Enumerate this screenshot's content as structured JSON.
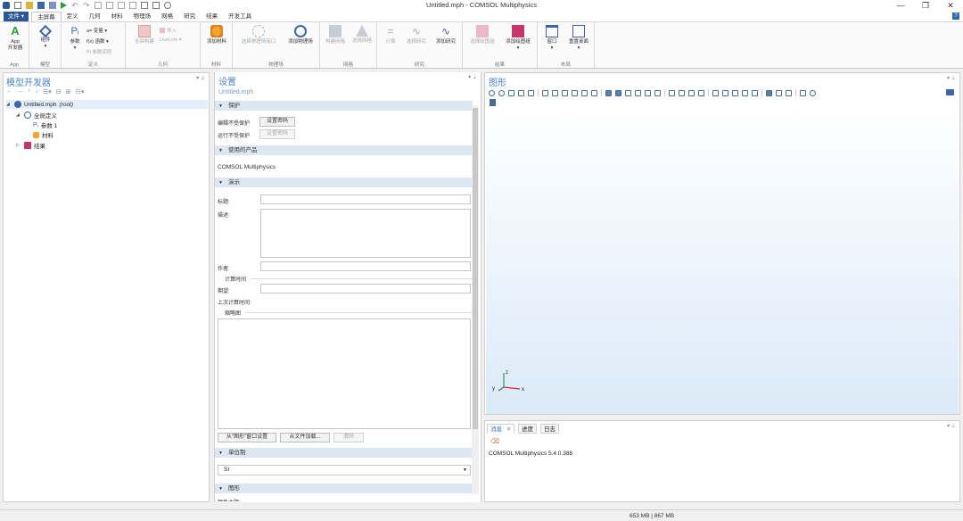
{
  "window": {
    "title": "Untitled.mph - COMSOL Multiphysics"
  },
  "ribbon": {
    "tabs": [
      "文件 ▾",
      "主屏幕",
      "定义",
      "几何",
      "材料",
      "物理场",
      "网格",
      "研究",
      "结果",
      "开发工具"
    ],
    "active_tab": "主屏幕",
    "groups": {
      "app": {
        "label": "App",
        "button": "App\n开发器"
      },
      "model": {
        "label": "模型",
        "button": "组件"
      },
      "definitions": {
        "label": "定义",
        "params": "参数",
        "variables": "a= 变量 ▾",
        "functions": "f(x) 函数 ▾",
        "param_case": "Pi 参数实例"
      },
      "geometry": {
        "label": "几何",
        "build_all": "全部构建",
        "import": "导入",
        "livelink": "LiveLink ▾"
      },
      "materials": {
        "label": "材料",
        "add_material": "添加材料"
      },
      "physics": {
        "label": "物理场",
        "select_iface": "选择物理场接口",
        "add_physics": "添加物理场"
      },
      "mesh": {
        "label": "网格",
        "build_mesh": "构建网格",
        "select_mesh": "选择网格"
      },
      "study": {
        "label": "研究",
        "compute": "计算",
        "select_study": "选择研究",
        "add_study": "添加研究"
      },
      "results": {
        "label": "结果",
        "select_plot": "选择绘图组",
        "add_plot": "添加绘图组"
      },
      "layout": {
        "label": "布局",
        "windows": "窗口",
        "reset_desktop": "重置桌面"
      }
    }
  },
  "model_builder": {
    "title": "模型开发器",
    "tree": [
      {
        "label": "Untitled.mph",
        "suffix": "(root)"
      },
      {
        "label": "全局定义"
      },
      {
        "label": "参数 1"
      },
      {
        "label": "材料"
      },
      {
        "label": "结果"
      }
    ]
  },
  "settings": {
    "title": "设置",
    "subtitle": "Untitled.mph",
    "sections": {
      "protection": "保护",
      "products": "使用的产品",
      "presentation": "演示",
      "unit_system": "单位制",
      "graphics": "图形"
    },
    "protection": {
      "edit_label": "编辑不受保护",
      "run_label": "运行不受保护",
      "set_password": "设置密码",
      "set_password2": "设置密码"
    },
    "products": [
      "COMSOL Multiphysics"
    ],
    "presentation": {
      "title_label": "标题:",
      "description_label": "描述:",
      "author_label": "作者:",
      "compute_time": "计算时间",
      "expected_label": "期望:",
      "last_compute_label": "上次计算时间:",
      "thumbnail": "缩略图",
      "from_graphics": "从\"图形\"窗口设置",
      "load_from_file": "从文件加载...",
      "clear": "清除"
    },
    "unit_system_value": "SI",
    "graphics_partial": "颜色主题:"
  },
  "graphics_panel": {
    "title": "图形",
    "axis_labels": {
      "x": "x",
      "y": "y",
      "z": "z"
    }
  },
  "messages": {
    "tabs": [
      "消息",
      "进度",
      "日志"
    ],
    "text": "COMSOL Multiphysics 5.4.0.388"
  },
  "status": {
    "memory": "653 MB | 867 MB"
  }
}
